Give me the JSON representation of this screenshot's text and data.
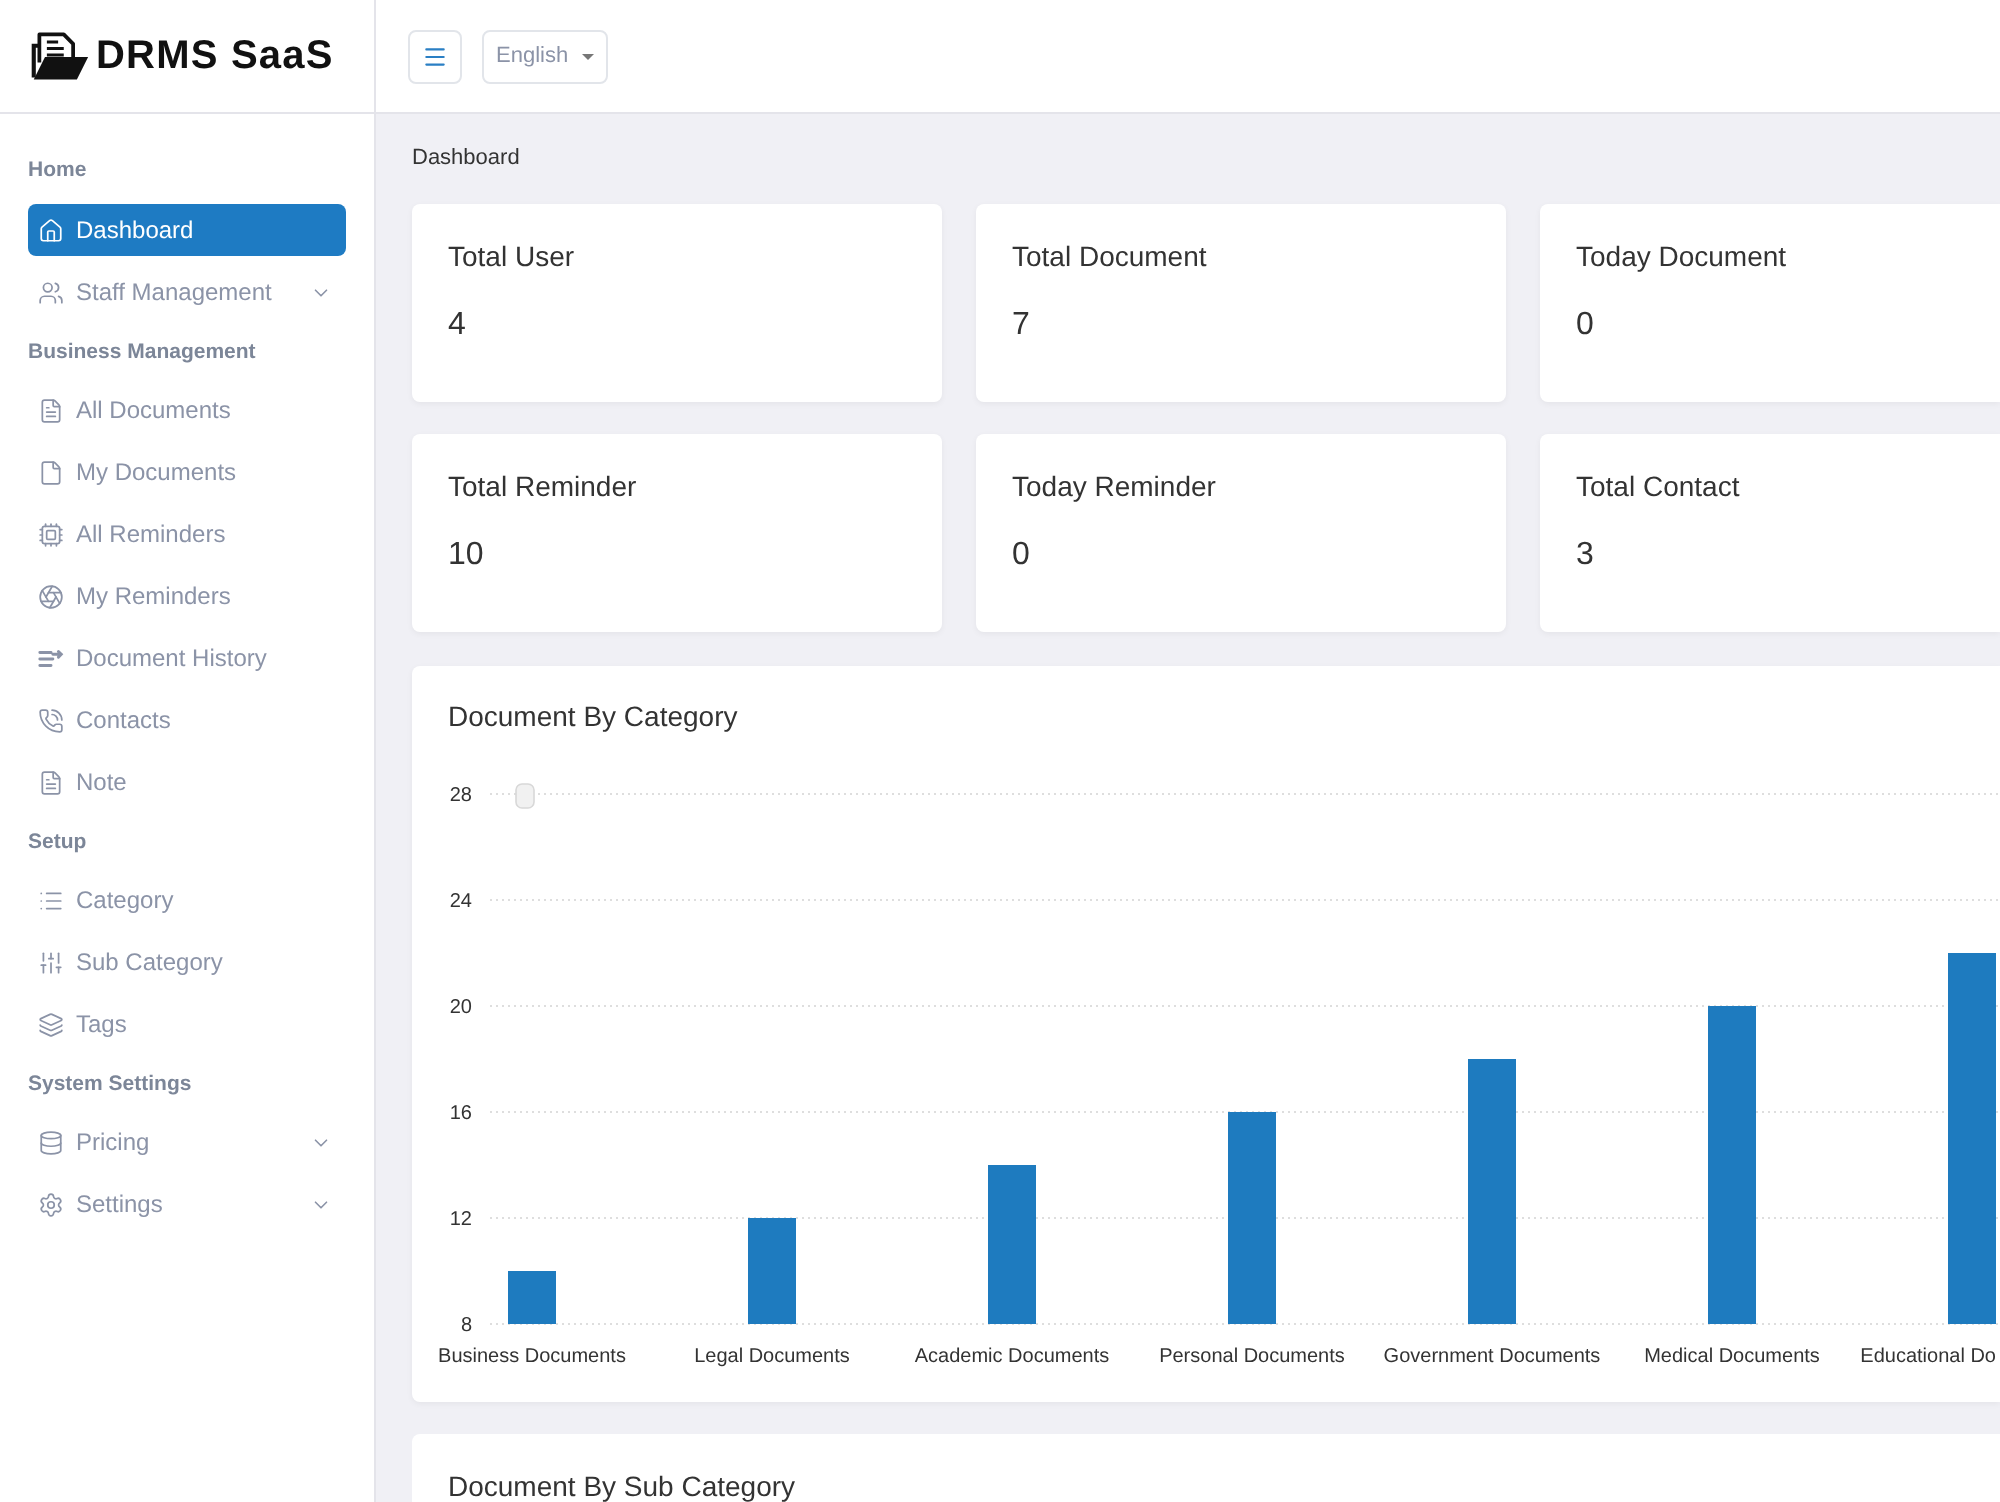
{
  "header": {
    "brand": "DRMS SaaS",
    "language": "English"
  },
  "sidebar": {
    "sections": [
      {
        "title": "Home",
        "items": [
          {
            "label": "Dashboard",
            "kind": "link",
            "selected": true
          },
          {
            "label": "Staff Management",
            "kind": "group",
            "selected": false
          }
        ]
      },
      {
        "title": "Business Management",
        "items": [
          {
            "label": "All Documents",
            "kind": "link",
            "selected": false
          },
          {
            "label": "My Documents",
            "kind": "link",
            "selected": false
          },
          {
            "label": "All Reminders",
            "kind": "link",
            "selected": false
          },
          {
            "label": "My Reminders",
            "kind": "link",
            "selected": false
          },
          {
            "label": "Document History",
            "kind": "link",
            "selected": false
          },
          {
            "label": "Contacts",
            "kind": "link",
            "selected": false
          },
          {
            "label": "Note",
            "kind": "link",
            "selected": false
          }
        ]
      },
      {
        "title": "Setup",
        "items": [
          {
            "label": "Category",
            "kind": "link",
            "selected": false
          },
          {
            "label": "Sub Category",
            "kind": "link",
            "selected": false
          },
          {
            "label": "Tags",
            "kind": "link",
            "selected": false
          }
        ]
      },
      {
        "title": "System Settings",
        "items": [
          {
            "label": "Pricing",
            "kind": "group",
            "selected": false
          },
          {
            "label": "Settings",
            "kind": "group",
            "selected": false
          }
        ]
      }
    ]
  },
  "breadcrumb": "Dashboard",
  "stats": [
    {
      "label": "Total User",
      "value": "4"
    },
    {
      "label": "Total Document",
      "value": "7"
    },
    {
      "label": "Today Document",
      "value": "0"
    },
    {
      "label": "Total Reminder",
      "value": "10"
    },
    {
      "label": "Today Reminder",
      "value": "0"
    },
    {
      "label": "Total Contact",
      "value": "3"
    }
  ],
  "category_chart": {
    "title": "Document By Category",
    "chart_data": {
      "type": "bar",
      "categories": [
        "Business Documents",
        "Legal Documents",
        "Academic Documents",
        "Personal Documents",
        "Government Documents",
        "Medical Documents",
        "Educational Do"
      ],
      "values": [
        10,
        12,
        14,
        16,
        18,
        20,
        22
      ],
      "ylim": [
        8,
        28
      ],
      "yticks": [
        8,
        12,
        16,
        20,
        24,
        28
      ],
      "grid": true
    }
  },
  "sub_category_chart": {
    "title": "Document By Sub Category"
  }
}
